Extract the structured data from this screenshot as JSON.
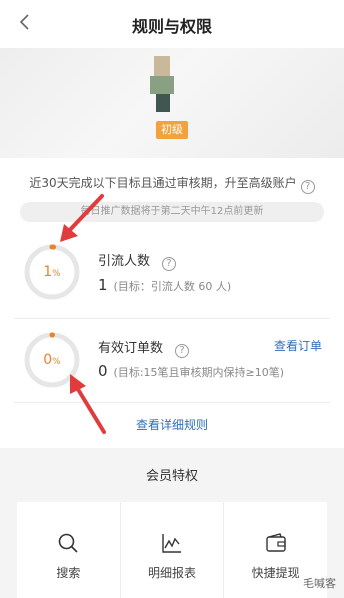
{
  "nav": {
    "title": "规则与权限",
    "back_icon": "chevron-left-icon"
  },
  "profile": {
    "level": "初级"
  },
  "main": {
    "intro": "近30天完成以下目标且通过审核期，升至高级账户",
    "notice": "每日推广数据将于第二天中午12点前更新",
    "metrics": [
      {
        "percent": "1",
        "percent_unit": "%",
        "progress": 0.01,
        "title": "引流人数",
        "value": "1",
        "goal": "(目标：引流人数 60 人)",
        "link": ""
      },
      {
        "percent": "0",
        "percent_unit": "%",
        "progress": 0.0,
        "title": "有效订单数",
        "value": "0",
        "goal": "(目标:15笔且审核期内保持≥10笔)",
        "link": "查看订单"
      }
    ],
    "detail_link": "查看详细规则"
  },
  "privileges": {
    "title": "会员特权",
    "items": [
      {
        "label": "搜索",
        "icon": "search-icon"
      },
      {
        "label": "明细报表",
        "icon": "chart-icon"
      },
      {
        "label": "快捷提现",
        "icon": "wallet-icon"
      }
    ]
  },
  "watermark": "毛喊客",
  "colors": {
    "accent": "#e8832b",
    "link": "#2f6fb8",
    "badge": "#f3a23b",
    "arrow": "#e23b3b"
  }
}
